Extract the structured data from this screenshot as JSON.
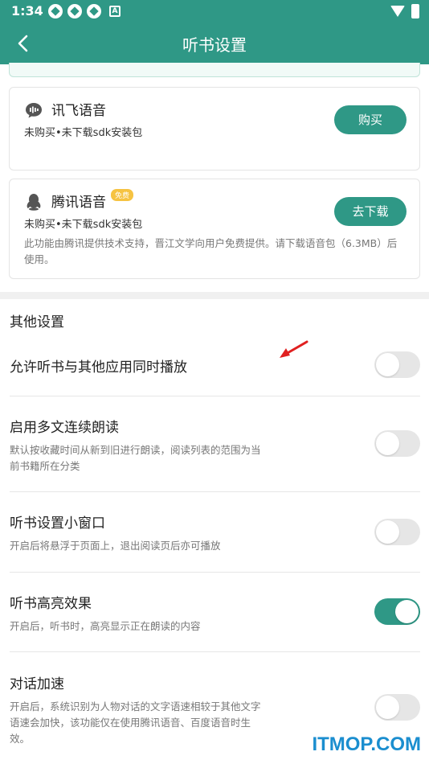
{
  "status_bar": {
    "time": "1:34",
    "notification_letter": "A"
  },
  "header": {
    "title": "听书设置"
  },
  "voices": [
    {
      "name": "讯飞语音",
      "status": "未购买•未下载sdk安装包",
      "button": "购买"
    },
    {
      "name": "腾讯语音",
      "badge": "免费",
      "status": "未购买•未下载sdk安装包",
      "description": "此功能由腾讯提供技术支持，晋江文学向用户免费提供。请下载语音包（6.3MB）后使用。",
      "button": "去下载"
    }
  ],
  "other": {
    "section_title": "其他设置",
    "settings": [
      {
        "title": "允许听书与其他应用同时播放",
        "desc": "",
        "enabled": false
      },
      {
        "title": "启用多文连续朗读",
        "desc": "默认按收藏时间从新到旧进行朗读，阅读列表的范围为当前书籍所在分类",
        "enabled": false
      },
      {
        "title": "听书设置小窗口",
        "desc": "开启后将悬浮于页面上，退出阅读页后亦可播放",
        "enabled": false
      },
      {
        "title": "听书高亮效果",
        "desc": "开启后，听书时，高亮显示正在朗读的内容",
        "enabled": true
      },
      {
        "title": "对话加速",
        "desc": "开启后，系统识别为人物对话的文字语速相较于其他文字语速会加快，该功能仅在使用腾讯语音、百度语音时生效。",
        "enabled": false
      }
    ]
  },
  "watermark": "ITMOP.COM",
  "colors": {
    "primary": "#2f9886",
    "badge": "#f6c342",
    "watermark": "#1b8ecf",
    "annotation_arrow": "#e02020"
  }
}
